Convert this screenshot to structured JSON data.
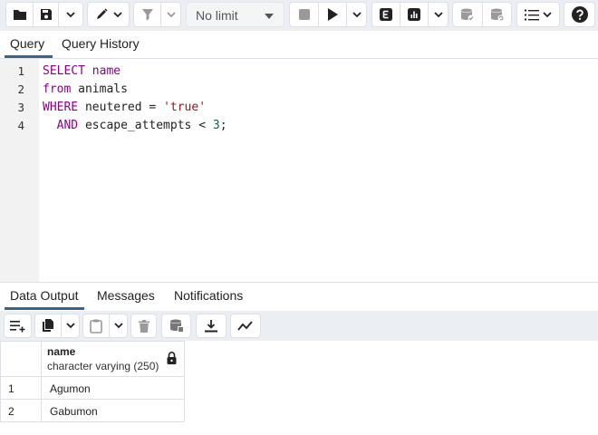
{
  "toolbar": {
    "limit_value": "No limit",
    "icons": [
      "folder-icon",
      "save-icon",
      "pen-icon",
      "filter-icon",
      "stop-icon",
      "play-icon",
      "explain-icon",
      "chart-icon",
      "commit-icon",
      "rollback-icon",
      "macros-icon",
      "help-icon"
    ]
  },
  "query_tabs": [
    {
      "label": "Query",
      "active": true
    },
    {
      "label": "Query History",
      "active": false
    }
  ],
  "editor": {
    "line_numbers": [
      "1",
      "2",
      "3",
      "4"
    ],
    "lines": [
      [
        "SELECT name"
      ],
      [
        "from animals"
      ],
      [
        "WHERE neutered = 'true'"
      ],
      [
        "  AND escape_attempts < 3;"
      ]
    ],
    "tokens": {
      "l1_kw": "SELECT",
      "l1_rest": " ",
      "l1_kw2": "name",
      "l2_kw": "from",
      "l2_rest": " animals",
      "l3_kw": "WHERE",
      "l3_rest": " neutered = ",
      "l3_str": "'true'",
      "l4_indent": "  ",
      "l4_kw": "AND",
      "l4_rest": " escape_attempts < ",
      "l4_num": "3",
      "l4_end": ";"
    }
  },
  "output_tabs": [
    {
      "label": "Data Output",
      "active": true
    },
    {
      "label": "Messages",
      "active": false
    },
    {
      "label": "Notifications",
      "active": false
    }
  ],
  "grid": {
    "columns": [
      {
        "name": "name",
        "type": "character varying (250)",
        "locked": true
      }
    ],
    "rows": [
      {
        "num": "1",
        "value": "Agumon"
      },
      {
        "num": "2",
        "value": "Gabumon"
      }
    ]
  },
  "colors": {
    "toolbar_bg": "#ebeef3",
    "active_tab": "#326690",
    "keyword": "#8b008b",
    "string": "#a31515",
    "number": "#116644"
  }
}
